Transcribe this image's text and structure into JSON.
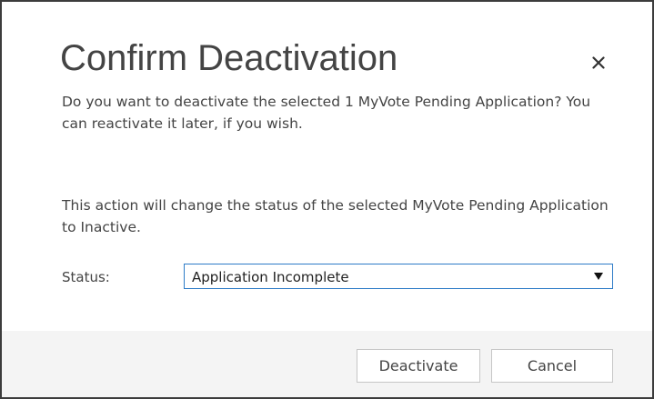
{
  "dialog": {
    "title": "Confirm Deactivation",
    "close_icon": "close-icon",
    "message_primary": "Do you want to deactivate the selected 1 MyVote Pending Application? You can reactivate it later, if you wish.",
    "message_secondary": "This action will change the status of the selected MyVote Pending Application to Inactive.",
    "status": {
      "label": "Status:",
      "selected_value": "Application Incomplete",
      "dropdown_icon": "triangle-down-icon"
    },
    "buttons": {
      "deactivate_label": "Deactivate",
      "cancel_label": "Cancel"
    }
  },
  "colors": {
    "border": "#3c3c3c",
    "text": "#444444",
    "select_border": "#2d7bc7",
    "footer_bg": "#f4f4f4",
    "button_border": "#c6c6c6"
  }
}
